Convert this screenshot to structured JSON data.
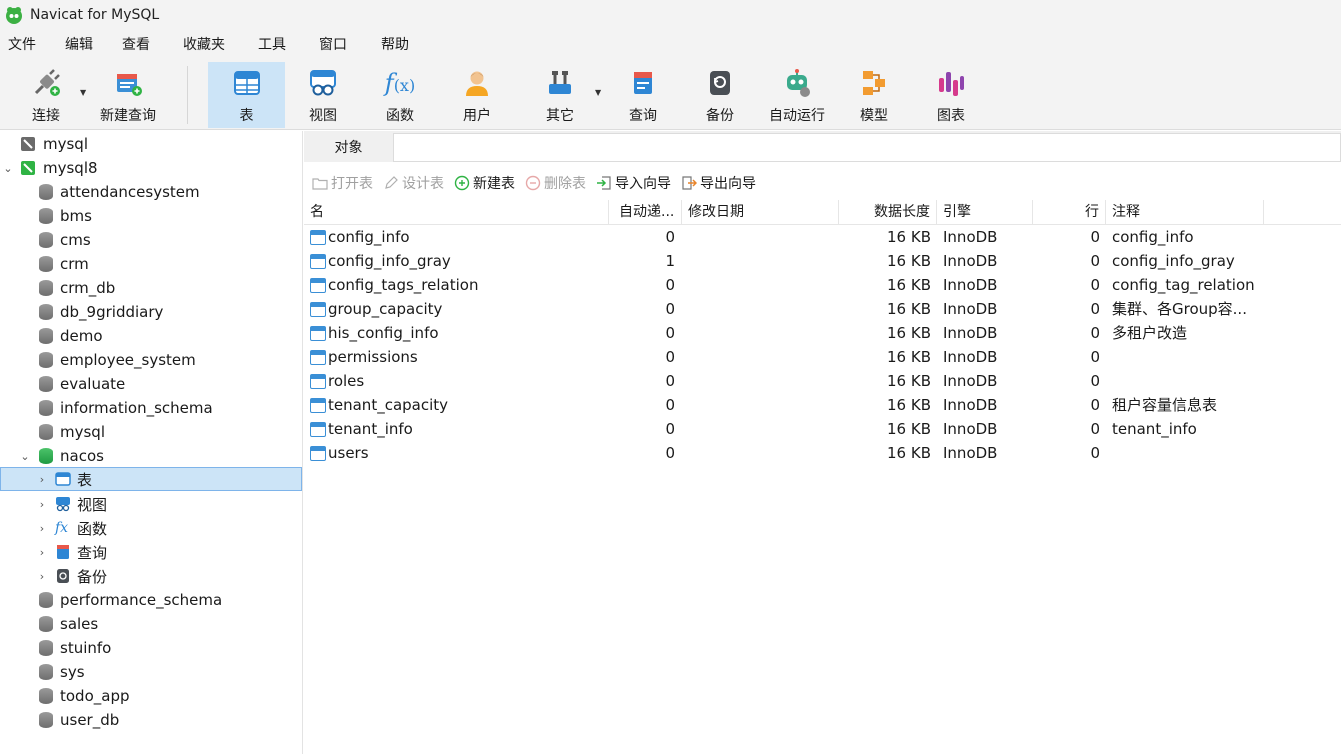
{
  "window": {
    "title": "Navicat for MySQL"
  },
  "menu": [
    "文件",
    "编辑",
    "查看",
    "收藏夹",
    "工具",
    "窗口",
    "帮助"
  ],
  "toolbar": {
    "connect": "连接",
    "new_query": "新建查询",
    "table": "表",
    "view": "视图",
    "function": "函数",
    "user": "用户",
    "other": "其它",
    "query": "查询",
    "backup": "备份",
    "automation": "自动运行",
    "model": "模型",
    "chart": "图表"
  },
  "tree": {
    "connections": [
      {
        "name": "mysql"
      },
      {
        "name": "mysql8"
      }
    ],
    "databases": [
      "attendancesystem",
      "bms",
      "cms",
      "crm",
      "crm_db",
      "db_9griddiary",
      "demo",
      "employee_system",
      "evaluate",
      "information_schema",
      "mysql",
      "nacos"
    ],
    "nacos_children": {
      "tables": "表",
      "views": "视图",
      "functions": "函数",
      "queries": "查询",
      "backups": "备份"
    },
    "databases_after": [
      "performance_schema",
      "sales",
      "stuinfo",
      "sys",
      "todo_app",
      "user_db"
    ]
  },
  "objects": {
    "tab_label": "对象",
    "toolbar": {
      "open_table": "打开表",
      "design_table": "设计表",
      "new_table": "新建表",
      "delete_table": "删除表",
      "import_wizard": "导入向导",
      "export_wizard": "导出向导"
    },
    "columns": [
      "名",
      "自动递...",
      "修改日期",
      "数据长度",
      "引擎",
      "行",
      "注释"
    ],
    "rows": [
      {
        "name": "config_info",
        "auto_inc": "0",
        "modified": "",
        "data_length": "16 KB",
        "engine": "InnoDB",
        "rows": "0",
        "comment": "config_info"
      },
      {
        "name": "config_info_gray",
        "auto_inc": "1",
        "modified": "",
        "data_length": "16 KB",
        "engine": "InnoDB",
        "rows": "0",
        "comment": "config_info_gray"
      },
      {
        "name": "config_tags_relation",
        "auto_inc": "0",
        "modified": "",
        "data_length": "16 KB",
        "engine": "InnoDB",
        "rows": "0",
        "comment": "config_tag_relation"
      },
      {
        "name": "group_capacity",
        "auto_inc": "0",
        "modified": "",
        "data_length": "16 KB",
        "engine": "InnoDB",
        "rows": "0",
        "comment": "集群、各Group容..."
      },
      {
        "name": "his_config_info",
        "auto_inc": "0",
        "modified": "",
        "data_length": "16 KB",
        "engine": "InnoDB",
        "rows": "0",
        "comment": "多租户改造"
      },
      {
        "name": "permissions",
        "auto_inc": "0",
        "modified": "",
        "data_length": "16 KB",
        "engine": "InnoDB",
        "rows": "0",
        "comment": ""
      },
      {
        "name": "roles",
        "auto_inc": "0",
        "modified": "",
        "data_length": "16 KB",
        "engine": "InnoDB",
        "rows": "0",
        "comment": ""
      },
      {
        "name": "tenant_capacity",
        "auto_inc": "0",
        "modified": "",
        "data_length": "16 KB",
        "engine": "InnoDB",
        "rows": "0",
        "comment": "租户容量信息表"
      },
      {
        "name": "tenant_info",
        "auto_inc": "0",
        "modified": "",
        "data_length": "16 KB",
        "engine": "InnoDB",
        "rows": "0",
        "comment": "tenant_info"
      },
      {
        "name": "users",
        "auto_inc": "0",
        "modified": "",
        "data_length": "16 KB",
        "engine": "InnoDB",
        "rows": "0",
        "comment": ""
      }
    ]
  },
  "colors": {
    "accent": "#3a8fd6",
    "selection": "#cce4f7",
    "toolbar_bg": "#f3f3f3"
  }
}
